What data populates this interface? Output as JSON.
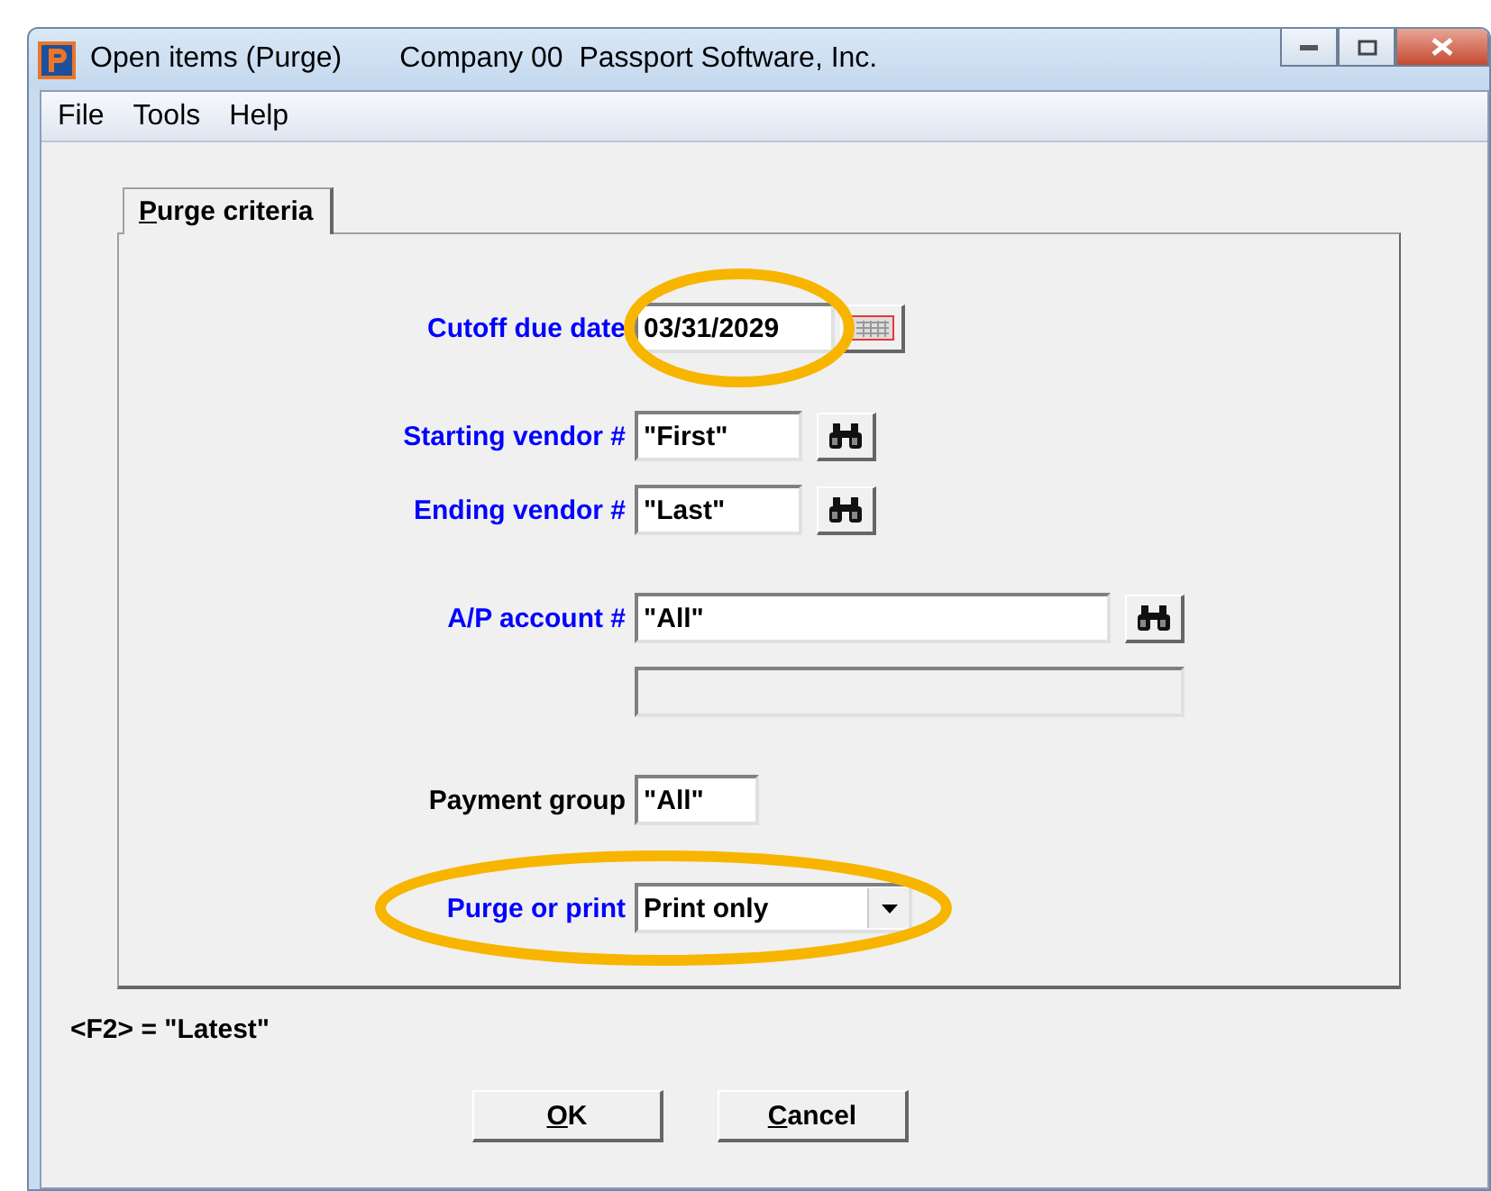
{
  "window": {
    "title": "Open items (Purge)",
    "company": "Company 00  Passport Software, Inc."
  },
  "menu": [
    "File",
    "Tools",
    "Help"
  ],
  "tabs": [
    {
      "label": "Purge criteria",
      "selected": true
    }
  ],
  "groups": [
    [
      {
        "kind": "date",
        "label": "Cutoff due date",
        "color": "#0000ff",
        "value": "03/31/2029",
        "highlighted": true
      }
    ],
    [
      {
        "kind": "lookup",
        "label": "Starting vendor #",
        "color": "#0000ff",
        "value": "\"First\"",
        "highlighted": false
      },
      {
        "kind": "lookup",
        "label": "Ending vendor #",
        "color": "#0000ff",
        "value": "\"Last\"",
        "highlighted": false
      }
    ],
    [
      {
        "kind": "wide-lookup",
        "label": "A/P account #",
        "color": "#0000ff",
        "value": "\"All\"",
        "highlighted": false
      },
      {
        "kind": "blank",
        "highlighted": false
      }
    ],
    [
      {
        "kind": "short",
        "label": "Payment group",
        "color": "#000000",
        "value": "\"All\"",
        "highlighted": false
      }
    ],
    [
      {
        "kind": "dropdown",
        "label": "Purge or print",
        "color": "#0000ff",
        "value": "Print only",
        "highlighted": true
      }
    ]
  ],
  "hint": "<F2> = \"Latest\"",
  "buttons": [
    {
      "label": "OK"
    },
    {
      "label": "Cancel"
    }
  ]
}
